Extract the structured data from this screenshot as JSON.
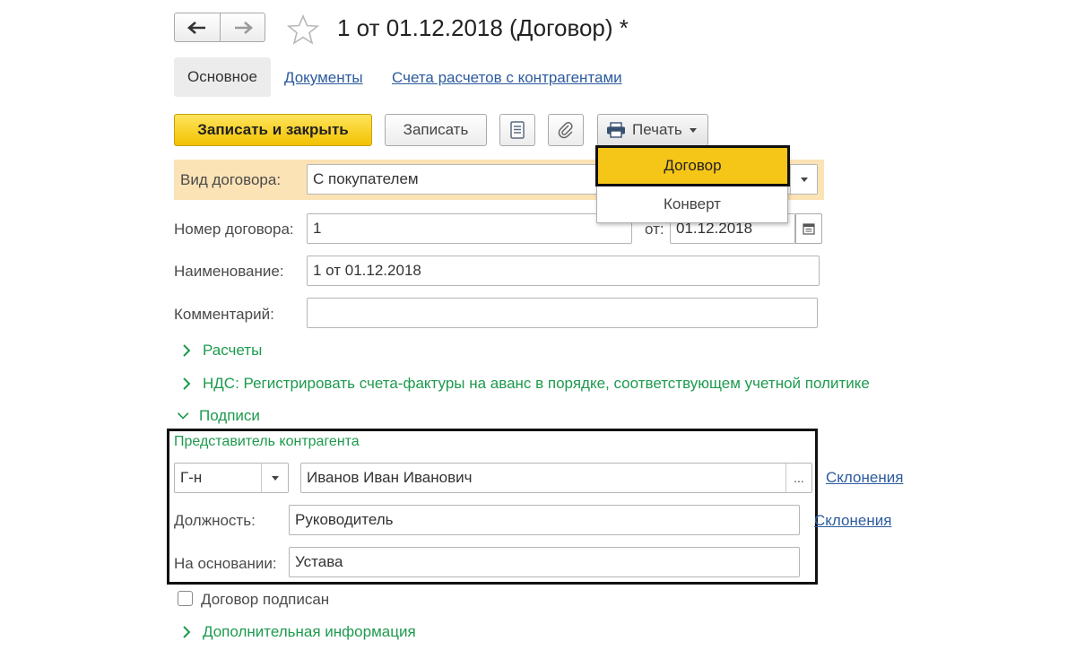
{
  "window": {
    "title": "1 от 01.12.2018 (Договор) *",
    "nav_back_icon": "arrow-left-icon",
    "nav_forward_icon": "arrow-right-icon",
    "favorite_icon": "star-icon"
  },
  "tabs": [
    {
      "label": "Основное",
      "active": true
    },
    {
      "label": "Документы",
      "active": false
    },
    {
      "label": "Счета расчетов с контрагентами",
      "active": false
    }
  ],
  "toolbar": {
    "save_close_label": "Записать и закрыть",
    "save_label": "Записать",
    "list_icon": "document-list-icon",
    "attach_icon": "paperclip-icon",
    "print_label": "Печать",
    "print_icon": "printer-icon"
  },
  "print_menu": {
    "items": [
      {
        "label": "Договор",
        "highlighted": true
      },
      {
        "label": "Конверт",
        "highlighted": false
      }
    ]
  },
  "form": {
    "contract_type_label": "Вид договора:",
    "contract_type_value": "С покупателем",
    "number_label": "Номер договора:",
    "number_value": "1",
    "date_label": "от:",
    "date_value": "01.12.2018",
    "name_label": "Наименование:",
    "name_value": "1 от 01.12.2018",
    "comment_label": "Комментарий:",
    "comment_value": ""
  },
  "sections": {
    "settlements": "Расчеты",
    "vat": "НДС: Регистрировать счета-фактуры на аванс в порядке, соответствующем учетной политике",
    "signatures": "Подписи",
    "additional": "Дополнительная информация"
  },
  "signatures": {
    "rep_title": "Представитель контрагента",
    "salutation_value": "Г-н",
    "rep_name_value": "Иванов Иван Иванович",
    "rep_select_label": "...",
    "declension_link": "Склонения",
    "position_label": "Должность:",
    "position_value": "Руководитель",
    "position_declension_link": "Склонения",
    "basis_label": "На основании:",
    "basis_value": "Устава"
  },
  "signed_checkbox": {
    "label": "Договор подписан",
    "checked": false
  },
  "colors": {
    "accent_yellow": "#f5c518",
    "highlight_band": "#fbe3b5",
    "section_green": "#1d9a4e",
    "link_blue": "#2c5b9e"
  }
}
